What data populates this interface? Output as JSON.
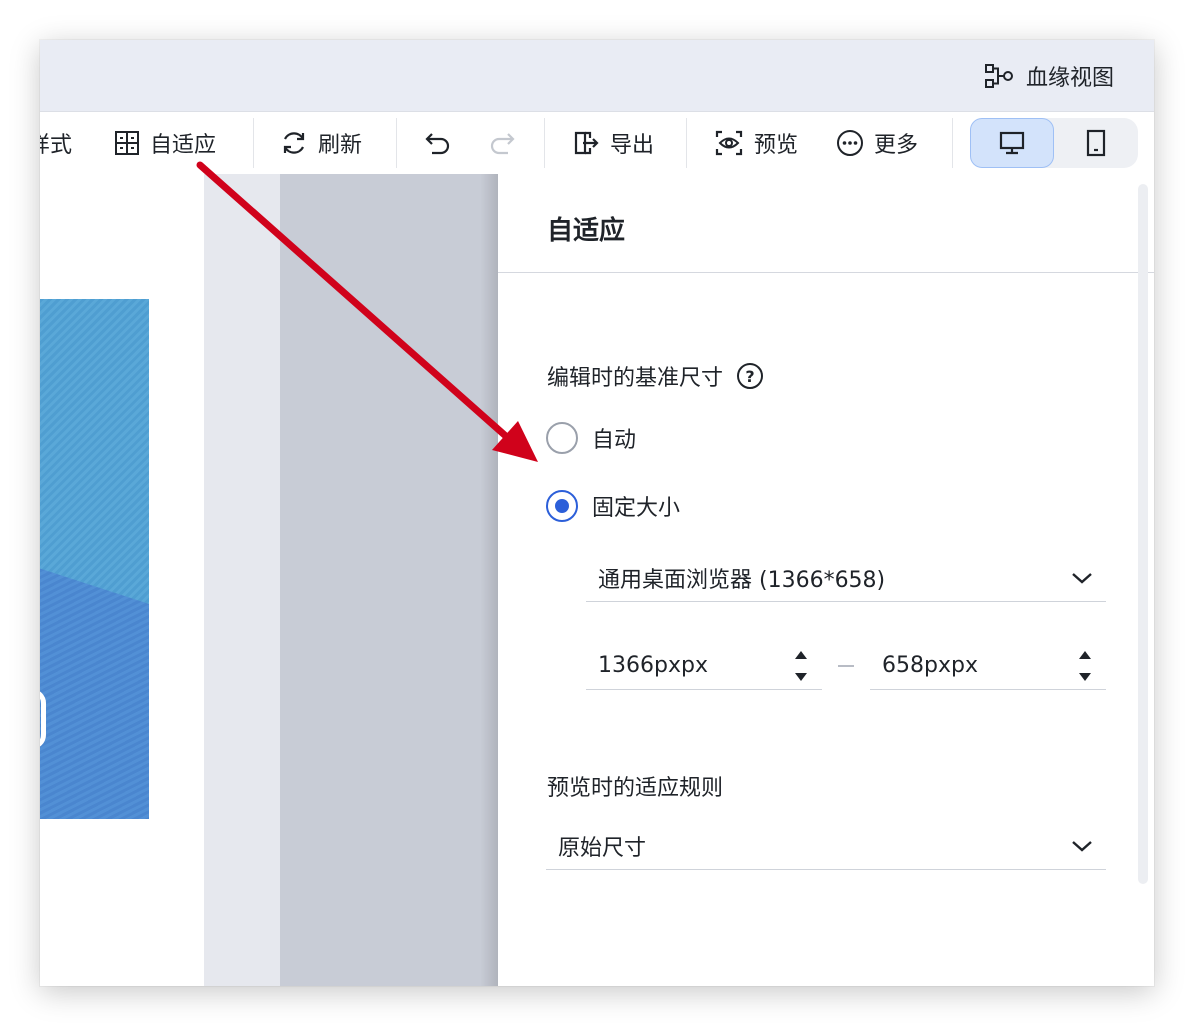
{
  "topbar": {
    "lineage_label": "血缘视图",
    "lineage_icon": "lineage-icon"
  },
  "toolbar": {
    "style_label": "样式",
    "adaptive_label": "自适应",
    "refresh_label": "刷新",
    "export_label": "导出",
    "preview_label": "预览",
    "more_label": "更多",
    "device_active": "desktop"
  },
  "panel": {
    "title": "自适应",
    "base_size_label": "编辑时的基准尺寸",
    "radio_auto_label": "自动",
    "radio_fixed_label": "固定大小",
    "selected_mode": "固定大小",
    "preset_value": "通用桌面浏览器 (1366*658)",
    "width_value": "1366pxpx",
    "height_value": "658pxpx",
    "preview_rule_label": "预览时的适应规则",
    "preview_rule_value": "原始尺寸"
  },
  "colors": {
    "accent": "#2c5fd9",
    "annotation_arrow": "#d0021b",
    "topbar_bg": "#e9ecf4"
  }
}
